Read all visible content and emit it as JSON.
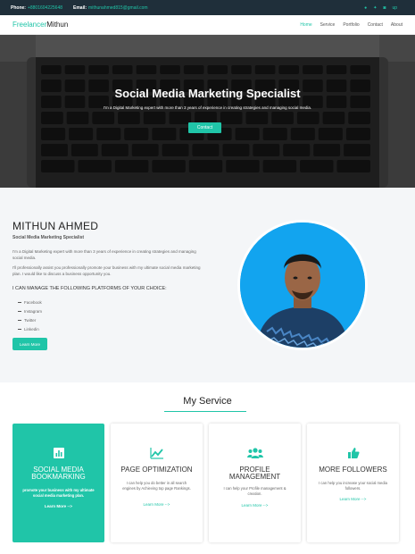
{
  "topbar": {
    "phone_label": "Phone:",
    "phone_value": "+8801604225648",
    "email_label": "Email:",
    "email_value": "mithunahmed815@gmail.com",
    "socials": [
      "facebook-icon",
      "twitter-icon",
      "instagram-icon",
      "upwork-icon"
    ],
    "socials_text": [
      "●",
      "✦",
      "◙",
      "up"
    ]
  },
  "navbar": {
    "brand_accent": "Freelancer",
    "brand_rest": "Mithun",
    "items": [
      "Home",
      "Service",
      "Portfolio",
      "Contact",
      "About"
    ],
    "active": "Home"
  },
  "hero": {
    "title": "Social Media Marketing Specialist",
    "subtitle": "I'm a Digital Marketing expert with more than 3 years of experience in creating strategies and managing social media.",
    "button": "Contact"
  },
  "about": {
    "name": "MITHUN AHMED",
    "role": "Social Media Marketing Specialist",
    "p1": "I'm a Digital Marketing expert with more than 3 years of experience in creating strategies and managing social media.",
    "p2": "I'll professionally assist you professionally promote your business with my ultimate social media marketing plan. I would like to discuss a business opportunity you.",
    "heading": "I CAN MANAGE THE FOLLOWING PLATFORMS OF YOUR CHOICE:",
    "platforms": [
      "Facebook",
      "Instagram",
      "Twitter",
      "Linkedin"
    ],
    "button": "Learn More"
  },
  "services": {
    "title": "My Service",
    "cards": [
      {
        "icon": "bar-chart-icon",
        "title": "SOCIAL MEDIA BOOKMARKING",
        "desc": "promote your business with my ultimate social media marketing plan.",
        "link": "Learn More -->"
      },
      {
        "icon": "trend-chart-icon",
        "title": "PAGE OPTIMIZATION",
        "desc": "I can help you do better in all search engines by Achieving top page Rankings.",
        "link": "Learn More -->"
      },
      {
        "icon": "users-icon",
        "title": "PROFILE MANAGEMENT",
        "desc": "I can help your Profile management & creation.",
        "link": "Learn More -->"
      },
      {
        "icon": "thumbs-up-icon",
        "title": "MORE FOLLOWERS",
        "desc": "I can help you increase your social media followers.",
        "link": "Learn More -->"
      }
    ]
  },
  "colors": {
    "accent": "#20c5a8",
    "topbar": "#1f2f3a",
    "about_bg": "#f4f6f8",
    "profile_bg": "#12a4ef"
  }
}
